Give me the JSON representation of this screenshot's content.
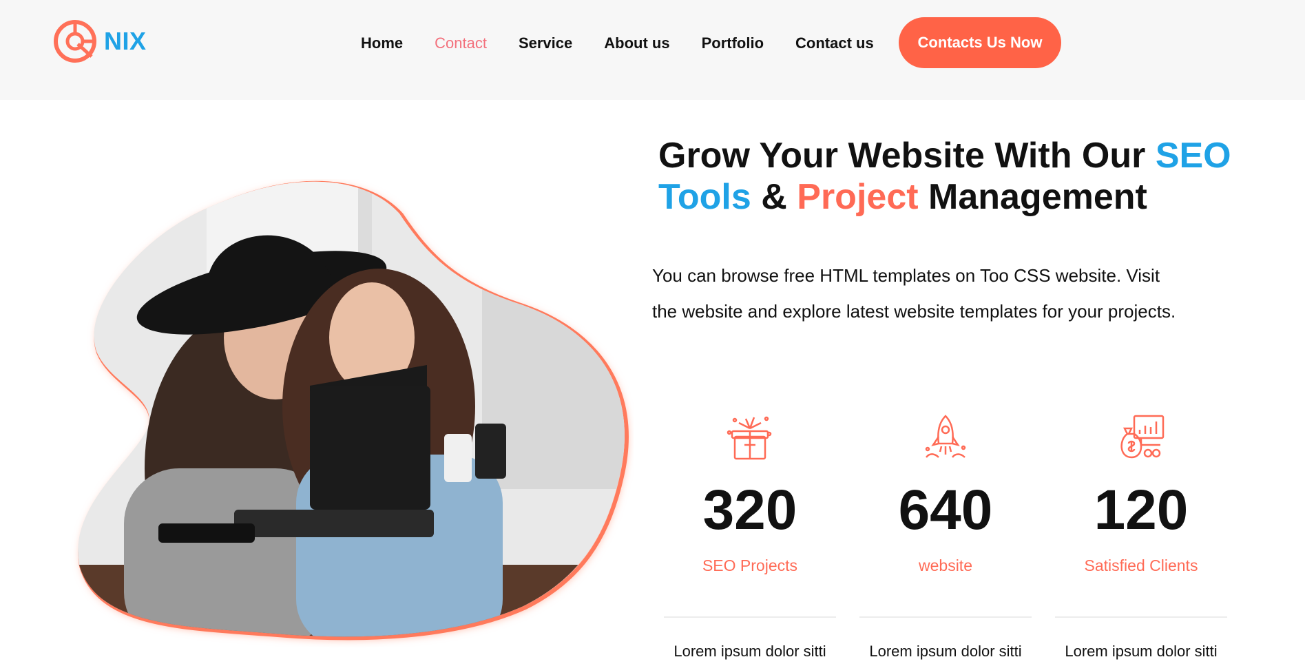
{
  "brand": {
    "name": "NIX",
    "accent": "#ff6347",
    "blue": "#1fa2e6"
  },
  "nav": {
    "items": [
      {
        "label": "Home",
        "active": false
      },
      {
        "label": "Contact",
        "active": true
      },
      {
        "label": "Service",
        "active": false
      },
      {
        "label": "About us",
        "active": false
      },
      {
        "label": "Portfolio",
        "active": false
      },
      {
        "label": "Contact us",
        "active": false
      }
    ],
    "cta_label": "Contacts Us Now"
  },
  "hero": {
    "heading": {
      "part1": "Grow Your Website With Our ",
      "seo": "SEO",
      "tools": "Tools",
      "amp": " & ",
      "project": "Project",
      "management": " Management"
    },
    "description": "You can browse free HTML templates on Too CSS website. Visit the website and explore latest website templates for your projects."
  },
  "stats": [
    {
      "icon": "gift-box-icon",
      "value": "320",
      "label": "SEO Projects",
      "text": "Lorem ipsum dolor sitti"
    },
    {
      "icon": "rocket-icon",
      "value": "640",
      "label": "website",
      "text": "Lorem ipsum dolor sitti"
    },
    {
      "icon": "money-chart-icon",
      "value": "120",
      "label": "Satisfied Clients",
      "text": "Lorem ipsum dolor sitti"
    }
  ]
}
